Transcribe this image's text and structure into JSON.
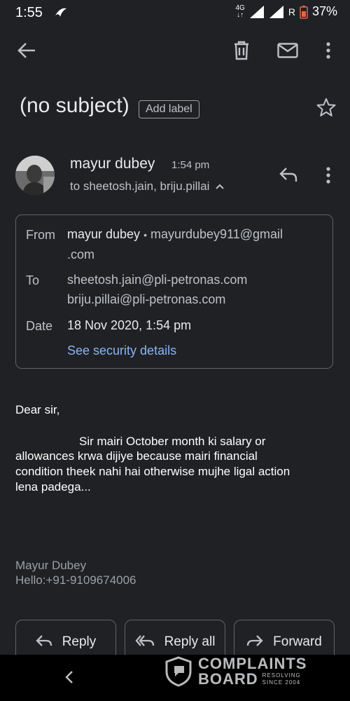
{
  "status_bar": {
    "time": "1:55",
    "network": "4G",
    "roaming": "R",
    "battery": "37%"
  },
  "email": {
    "subject": "(no subject)",
    "add_label": "Add label",
    "sender": {
      "name": "mayur dubey",
      "time": "1:54 pm",
      "recipients_summary": "to sheetosh.jain, briju.pillai"
    },
    "details": {
      "from_label": "From",
      "from_name": "mayur dubey",
      "from_sep": "•",
      "from_email_line1": "mayurdubey911@gmail",
      "from_email_line2": ".com",
      "to_label": "To",
      "to": [
        "sheetosh.jain@pli-petronas.com",
        "briju.pillai@pli-petronas.com"
      ],
      "date_label": "Date",
      "date": "18 Nov 2020, 1:54 pm",
      "security_link": "See security details"
    },
    "body": {
      "greeting": "Dear sir,",
      "lines": [
        "Sir mairi October month ki salary or",
        "allowances krwa dijiye because mairi financial",
        "condition theek nahi hai otherwise mujhe ligal action",
        "lena padega..."
      ]
    },
    "signature": {
      "name": "Mayur Dubey",
      "phone": "Hello:+91-9109674006"
    }
  },
  "actions": {
    "reply": "Reply",
    "reply_all": "Reply all",
    "forward": "Forward"
  },
  "watermark": {
    "line1": "COMPLAINTS",
    "line2": "BOARD",
    "tag1": "RESOLVING",
    "tag2": "SINCE 2004"
  },
  "colors": {
    "background": "#202124",
    "link": "#8ab4f8",
    "muted": "#bdc1c6"
  }
}
